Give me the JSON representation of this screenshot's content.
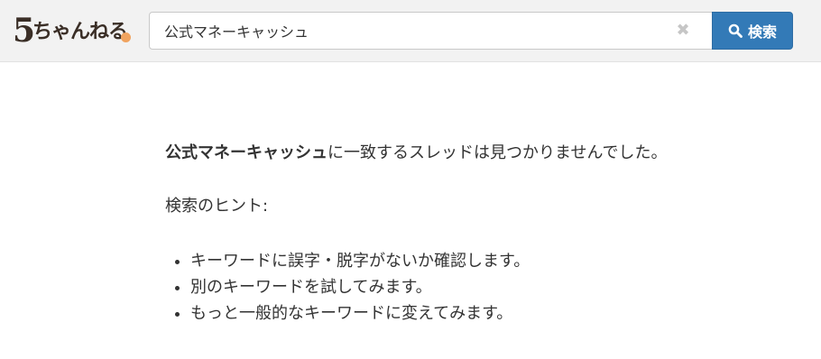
{
  "header": {
    "logo": {
      "digit": "5",
      "kana": "ちゃんねる"
    },
    "search": {
      "value": "公式マネーキャッシュ",
      "clear_icon": "close-icon",
      "button_label": "検索",
      "button_icon": "search-icon",
      "button_color": "#337ab7"
    }
  },
  "main": {
    "query": "公式マネーキャッシュ",
    "no_result_suffix": "に一致するスレッドは見つかりませんでした。",
    "hints_title": "検索のヒント:",
    "hints": [
      "キーワードに誤字・脱字がないか確認します。",
      "別のキーワードを試してみます。",
      "もっと一般的なキーワードに変えてみます。"
    ]
  }
}
